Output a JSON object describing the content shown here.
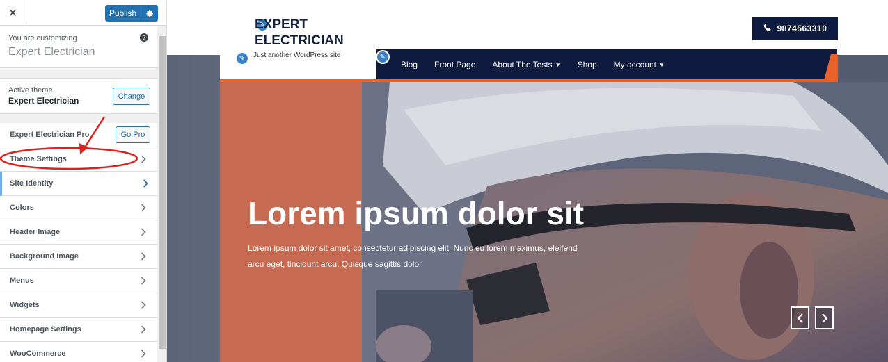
{
  "sidebar": {
    "close_icon": "close-icon",
    "publish_label": "Publish",
    "customizing_label": "You are customizing",
    "customizing_title": "Expert Electrician",
    "active_theme_label": "Active theme",
    "active_theme_name": "Expert Electrician",
    "change_label": "Change",
    "pro_row": {
      "label": "Expert Electrician Pro",
      "button": "Go Pro"
    },
    "sections": [
      {
        "label": "Theme Settings"
      },
      {
        "label": "Site Identity"
      },
      {
        "label": "Colors"
      },
      {
        "label": "Header Image"
      },
      {
        "label": "Background Image"
      },
      {
        "label": "Menus"
      },
      {
        "label": "Widgets"
      },
      {
        "label": "Homepage Settings"
      },
      {
        "label": "WooCommerce"
      }
    ]
  },
  "preview": {
    "site_title": "EXPERT ELECTRICIAN",
    "tagline": "Just another WordPress site",
    "phone": "9874563310",
    "nav": [
      "Blog",
      "Front Page",
      "About The Tests",
      "Shop",
      "My account"
    ],
    "hero_title": "Lorem ipsum dolor sit",
    "hero_text": "Lorem ipsum dolor sit amet, consectetur adipiscing elit. Nunc eu lorem maximus, eleifend arcu eget, tincidunt arcu. Quisque sagittis dolor"
  },
  "colors": {
    "wp_blue": "#2271b1",
    "navy": "#0e1a3e",
    "accent_orange": "#e8622a",
    "annotation_red": "#e0201b"
  }
}
